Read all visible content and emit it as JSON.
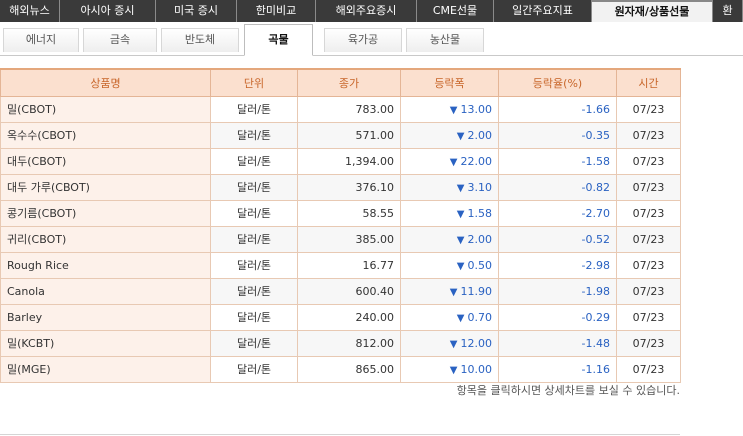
{
  "top_tabs": [
    "해외뉴스",
    "아시아 증시",
    "미국 증시",
    "한미비교",
    "해외주요증시",
    "CME선물",
    "일간주요지표",
    "원자재/상품선물",
    "환"
  ],
  "sub_tabs": [
    "에너지",
    "금속",
    "반도체",
    "곡물",
    "육가공",
    "농산물"
  ],
  "table": {
    "headers": [
      "상품명",
      "단위",
      "종가",
      "등락폭",
      "등락율(%)",
      "시간"
    ],
    "rows": [
      {
        "name": "밀(CBOT)",
        "unit": "달러/톤",
        "close": "783.00",
        "arrow": "▼",
        "change": "13.00",
        "rate": "-1.66",
        "time": "07/23"
      },
      {
        "name": "옥수수(CBOT)",
        "unit": "달러/톤",
        "close": "571.00",
        "arrow": "▼",
        "change": "2.00",
        "rate": "-0.35",
        "time": "07/23"
      },
      {
        "name": "대두(CBOT)",
        "unit": "달러/톤",
        "close": "1,394.00",
        "arrow": "▼",
        "change": "22.00",
        "rate": "-1.58",
        "time": "07/23"
      },
      {
        "name": "대두 가루(CBOT)",
        "unit": "달러/톤",
        "close": "376.10",
        "arrow": "▼",
        "change": "3.10",
        "rate": "-0.82",
        "time": "07/23"
      },
      {
        "name": "콩기름(CBOT)",
        "unit": "달러/톤",
        "close": "58.55",
        "arrow": "▼",
        "change": "1.58",
        "rate": "-2.70",
        "time": "07/23"
      },
      {
        "name": "귀리(CBOT)",
        "unit": "달러/톤",
        "close": "385.00",
        "arrow": "▼",
        "change": "2.00",
        "rate": "-0.52",
        "time": "07/23"
      },
      {
        "name": "Rough Rice",
        "unit": "달러/톤",
        "close": "16.77",
        "arrow": "▼",
        "change": "0.50",
        "rate": "-2.98",
        "time": "07/23"
      },
      {
        "name": "Canola",
        "unit": "달러/톤",
        "close": "600.40",
        "arrow": "▼",
        "change": "11.90",
        "rate": "-1.98",
        "time": "07/23"
      },
      {
        "name": "Barley",
        "unit": "달러/톤",
        "close": "240.00",
        "arrow": "▼",
        "change": "0.70",
        "rate": "-0.29",
        "time": "07/23"
      },
      {
        "name": "밀(KCBT)",
        "unit": "달러/톤",
        "close": "812.00",
        "arrow": "▼",
        "change": "12.00",
        "rate": "-1.48",
        "time": "07/23"
      },
      {
        "name": "밀(MGE)",
        "unit": "달러/톤",
        "close": "865.00",
        "arrow": "▼",
        "change": "10.00",
        "rate": "-1.16",
        "time": "07/23"
      }
    ]
  },
  "note": "항목을 클릭하시면 상세차트를 보실 수 있습니다."
}
